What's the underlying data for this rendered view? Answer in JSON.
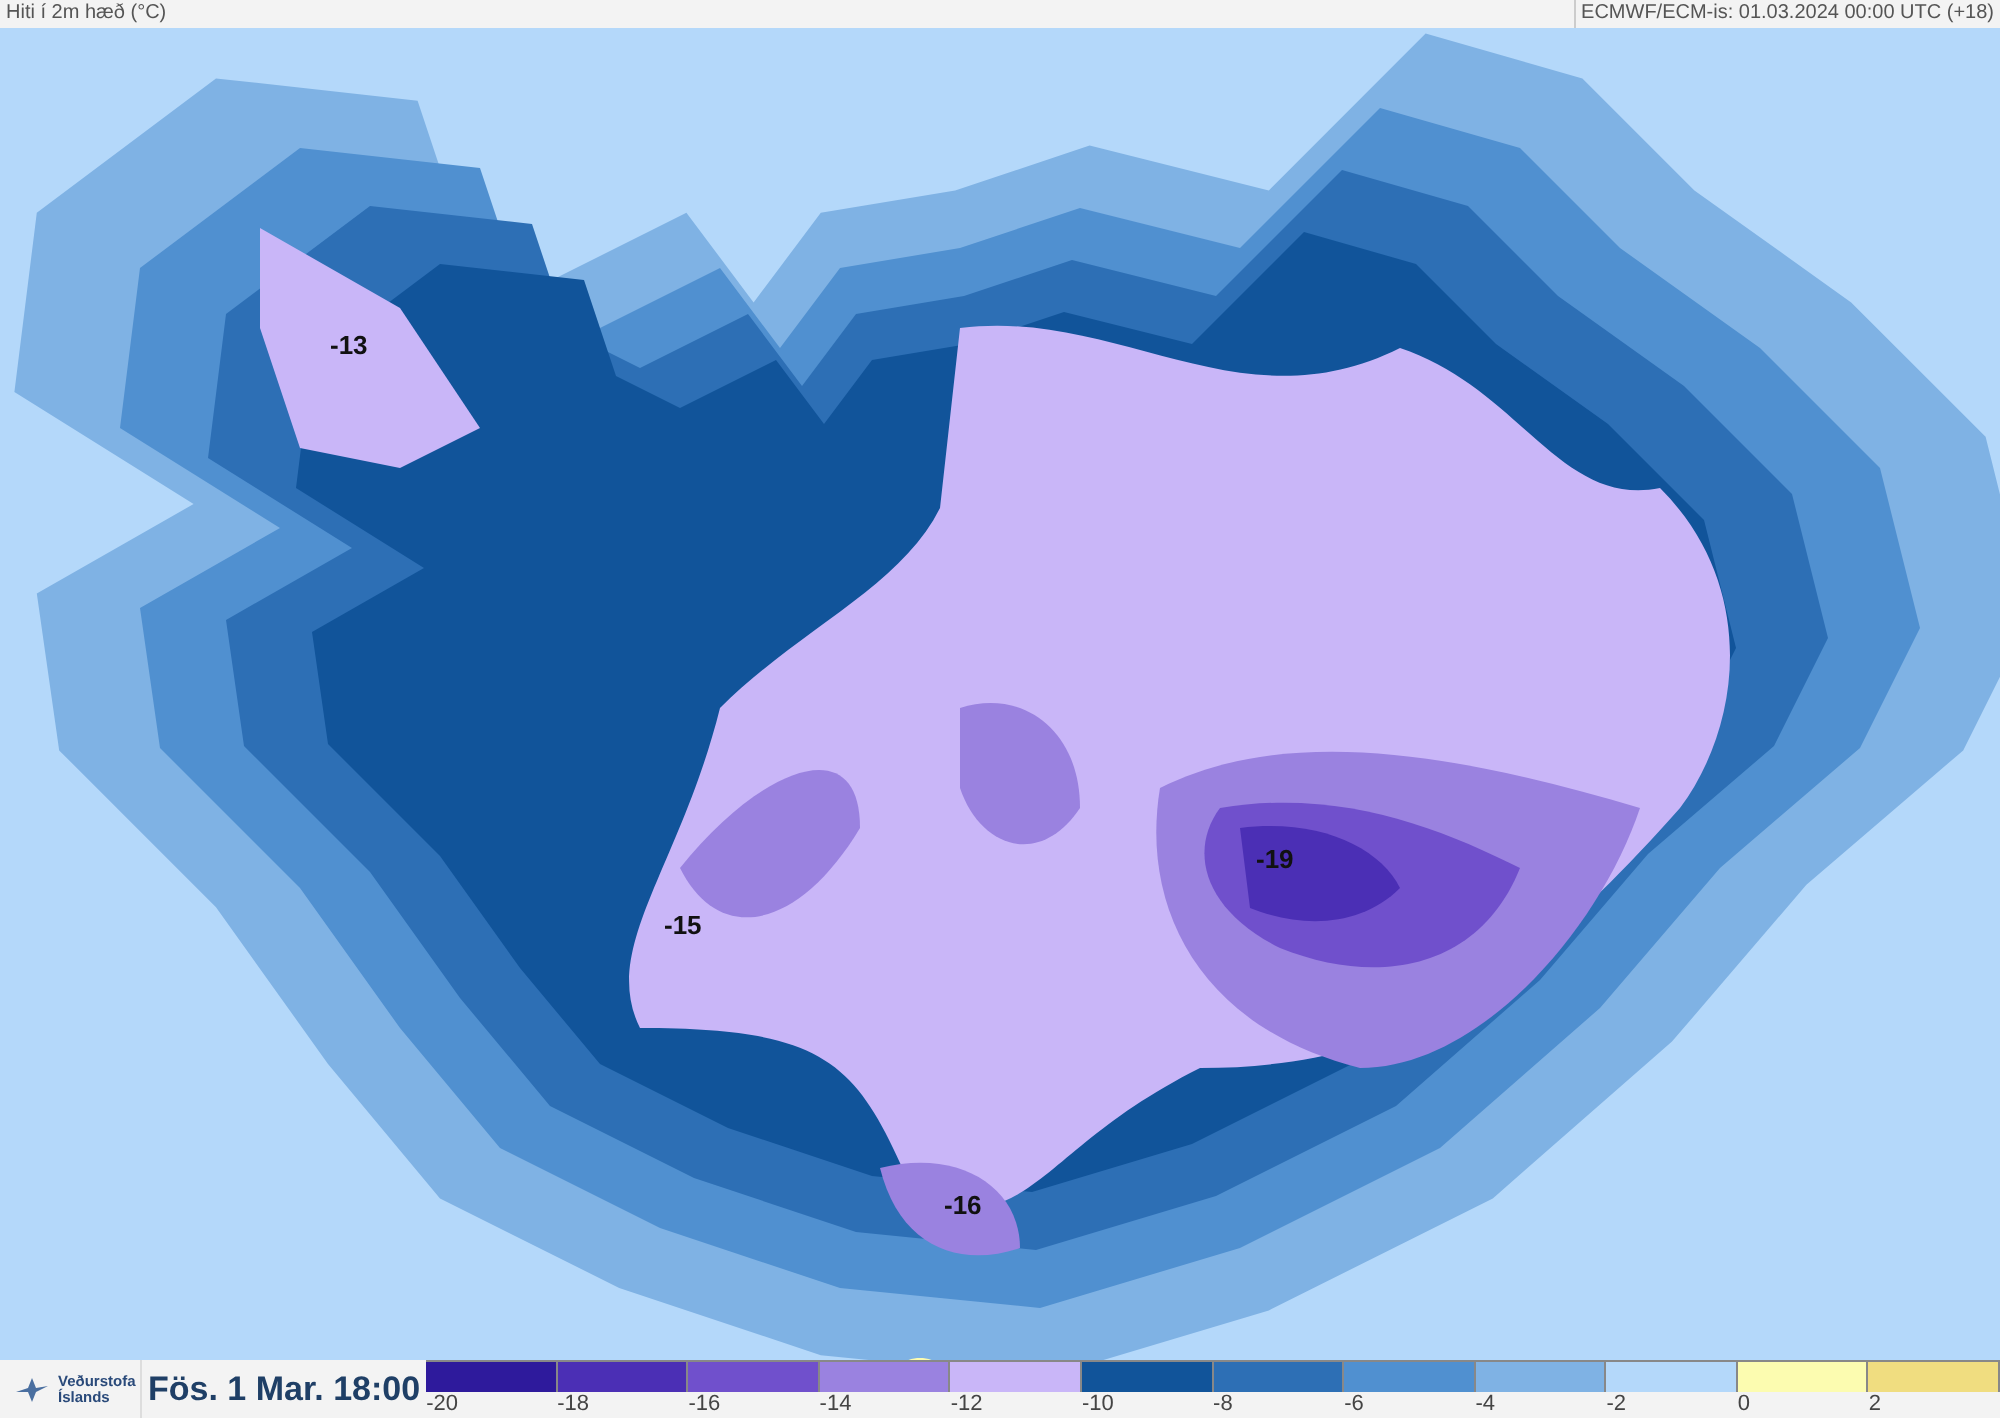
{
  "header": {
    "title": "Hiti í 2m hæð (°C)",
    "model_run": "ECMWF/ECM-is: 01.03.2024 00:00 UTC (+18)"
  },
  "map": {
    "labels": [
      "-13",
      "-15",
      "-19",
      "-16"
    ]
  },
  "footer": {
    "logo_lines": [
      "Veðurstofa",
      "Íslands"
    ],
    "valid_time": "Fös. 1 Mar. 18:00"
  },
  "legend": {
    "bins": [
      {
        "color": "#2e1a9c"
      },
      {
        "color": "#4b2fb5"
      },
      {
        "color": "#7050cc"
      },
      {
        "color": "#9a82e0"
      },
      {
        "color": "#c9b6f8"
      },
      {
        "color": "#11549a"
      },
      {
        "color": "#2d6fb5"
      },
      {
        "color": "#5090d0"
      },
      {
        "color": "#7fb2e4"
      },
      {
        "color": "#b4d8fa"
      },
      {
        "color": "#fcfcb0"
      },
      {
        "color": "#f0dd80"
      }
    ],
    "ticks": [
      "-20",
      "-18",
      "-16",
      "-14",
      "-12",
      "-10",
      "-8",
      "-6",
      "-4",
      "-2",
      "0",
      "2"
    ]
  }
}
